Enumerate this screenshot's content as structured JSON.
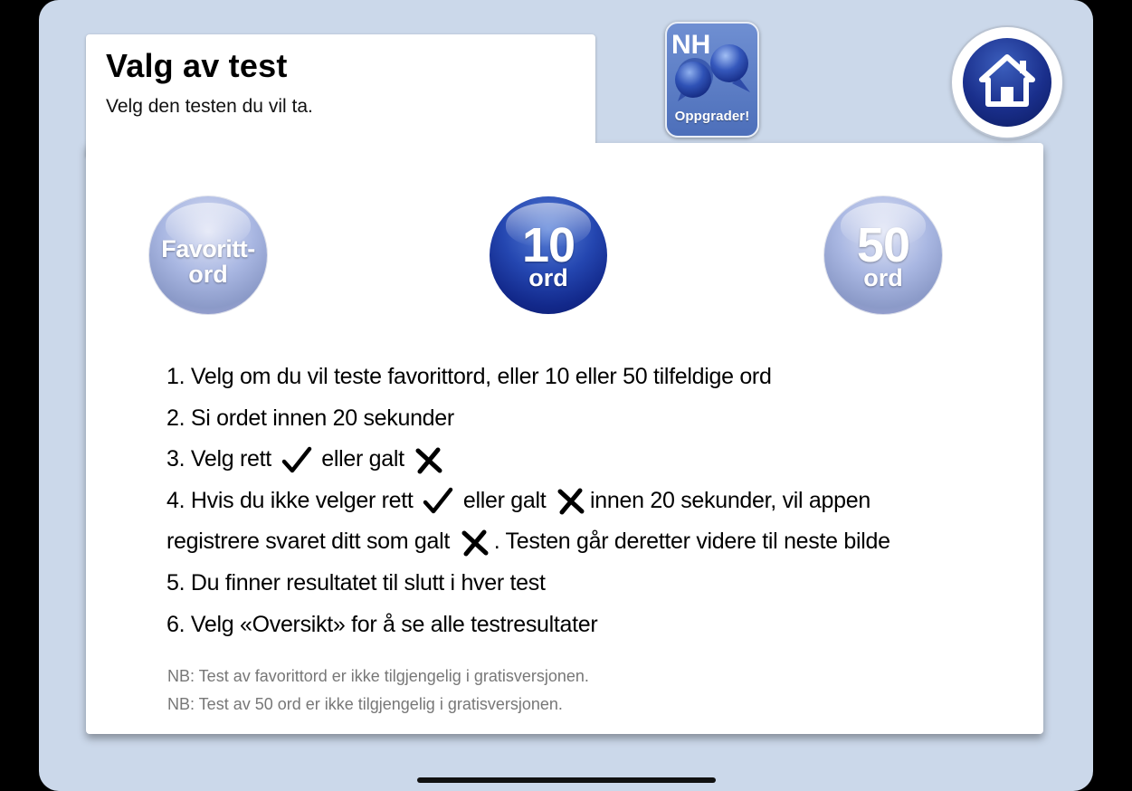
{
  "header": {
    "title": "Valg av test",
    "subtitle": "Velg den testen du vil ta."
  },
  "upgrade_button": {
    "logo": "NH",
    "label": "Oppgrader!",
    "icon": "speech-bubbles-icon"
  },
  "home_button": {
    "icon": "house-icon"
  },
  "tests": {
    "favorites": {
      "line1": "Favoritt-",
      "line2": "ord"
    },
    "ten": {
      "number": "10",
      "unit": "ord"
    },
    "fifty": {
      "number": "50",
      "unit": "ord"
    }
  },
  "instructions": {
    "step1": "1. Velg om du vil teste favorittord, eller 10 eller 50 tilfeldige ord",
    "step2": "2. Si ordet innen 20 sekunder",
    "step3a": "3. Velg rett",
    "step3b": "eller galt",
    "step4a": "4. Hvis du ikke velger rett",
    "step4b": "eller galt",
    "step4c": "innen 20 sekunder, vil appen",
    "step4d": "registrere svaret ditt som galt",
    "step4e": ". Testen går deretter videre til neste bilde",
    "step5": "5. Du finner resultatet til slutt i hver test",
    "step6": "6. Velg «Oversikt» for å se alle testresultater"
  },
  "notes": {
    "note1": "NB: Test av favorittord er ikke tilgjengelig i gratisversjonen.",
    "note2": "NB: Test av 50 ord er ikke tilgjengelig i gratisversjonen."
  },
  "icons": {
    "right": "checkmark-icon",
    "wrong": "cross-icon"
  },
  "colors": {
    "background": "#cbd8ea",
    "dark_button": "#1a2f8c",
    "light_button": "#a9b7e2",
    "note_text": "#777777"
  }
}
